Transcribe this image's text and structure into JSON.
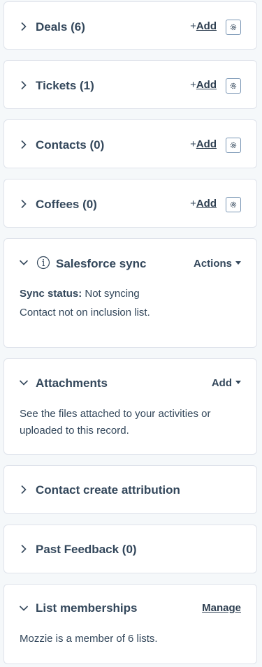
{
  "cards": {
    "deals": {
      "title": "Deals (6)",
      "add_plus": "+",
      "add_label": "Add",
      "settings_icon": "gear-icon"
    },
    "tickets": {
      "title": "Tickets (1)",
      "add_plus": "+",
      "add_label": "Add",
      "settings_icon": "gear-icon"
    },
    "contacts": {
      "title": "Contacts (0)",
      "add_plus": "+",
      "add_label": "Add",
      "settings_icon": "gear-icon"
    },
    "coffees": {
      "title": "Coffees (0)",
      "add_plus": "+",
      "add_label": "Add",
      "settings_icon": "gear-icon"
    },
    "salesforce": {
      "title": "Salesforce sync",
      "actions_label": "Actions",
      "status_label": "Sync status:",
      "status_value": "Not syncing",
      "note": "Contact not on inclusion list."
    },
    "attachments": {
      "title": "Attachments",
      "add_label": "Add",
      "description": "See the files attached to your activities or uploaded to this record."
    },
    "attribution": {
      "title": "Contact create attribution"
    },
    "feedback": {
      "title": "Past Feedback (0)"
    },
    "lists": {
      "title": "List memberships",
      "manage_label": "Manage",
      "description": "Mozzie is a member of 6 lists."
    }
  },
  "colors": {
    "text": "#33475b",
    "border": "#dfe3eb",
    "background": "#f5f8fa",
    "card": "#ffffff"
  }
}
